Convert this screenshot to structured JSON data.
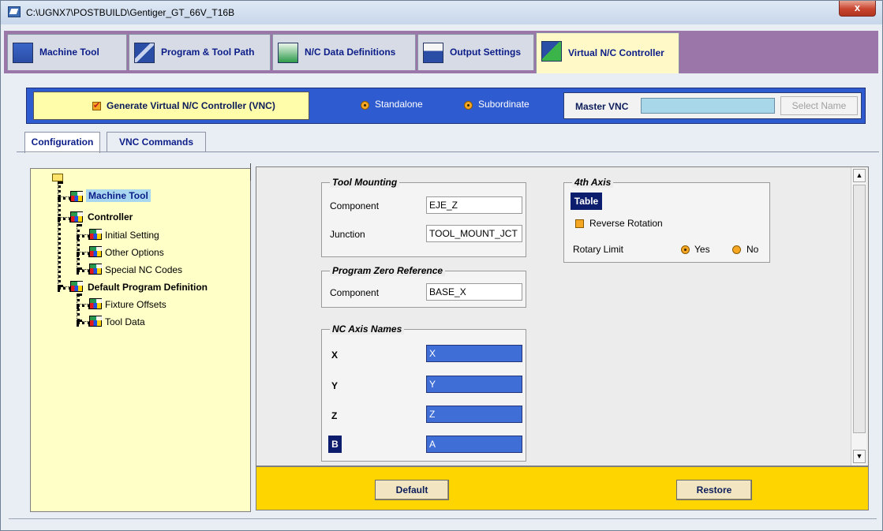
{
  "window": {
    "title": "C:\\UGNX7\\POSTBUILD\\Gentiger_GT_66V_T16B",
    "close_glyph": "x"
  },
  "main_tabs": [
    {
      "label": "Machine Tool",
      "icon": "machine-tool-icon"
    },
    {
      "label": "Program & Tool Path",
      "icon": "program-tool-path-icon"
    },
    {
      "label": "N/C Data Definitions",
      "icon": "nc-data-icon"
    },
    {
      "label": "Output Settings",
      "icon": "printer-icon"
    },
    {
      "label": "Virtual N/C Controller",
      "icon": "vnc-icon"
    }
  ],
  "vnc": {
    "generate_label": "Generate Virtual N/C Controller (VNC)",
    "generate_checked": true,
    "standalone_label": "Standalone",
    "subordinate_label": "Subordinate",
    "master_label": "Master VNC",
    "master_value": "",
    "select_name": "Select Name"
  },
  "sub_tabs": [
    "Configuration",
    "VNC Commands"
  ],
  "tree": {
    "nodes": [
      {
        "label": "Machine Tool",
        "level": 1,
        "bold": true,
        "selected": true
      },
      {
        "label": "Controller",
        "level": 1,
        "bold": true
      },
      {
        "label": "Initial Setting",
        "level": 2
      },
      {
        "label": "Other Options",
        "level": 2
      },
      {
        "label": "Special NC Codes",
        "level": 2
      },
      {
        "label": "Default Program Definition",
        "level": 1,
        "bold": true
      },
      {
        "label": "Fixture Offsets",
        "level": 2
      },
      {
        "label": "Tool Data",
        "level": 2
      }
    ]
  },
  "tool_mounting": {
    "title": "Tool Mounting",
    "component_label": "Component",
    "component_value": "EJE_Z",
    "junction_label": "Junction",
    "junction_value": "TOOL_MOUNT_JCT"
  },
  "program_zero": {
    "title": "Program Zero Reference",
    "component_label": "Component",
    "component_value": "BASE_X"
  },
  "axis_names": {
    "title": "NC Axis Names",
    "rows": [
      {
        "label": "X",
        "value": "X"
      },
      {
        "label": "Y",
        "value": "Y"
      },
      {
        "label": "Z",
        "value": "Z"
      },
      {
        "label": "B",
        "value": "A"
      }
    ]
  },
  "fourth_axis": {
    "title": "4th Axis",
    "type_label": "Table",
    "reverse_label": "Reverse Rotation",
    "rotary_limit_label": "Rotary Limit",
    "yes_label": "Yes",
    "no_label": "No",
    "rotary_limit_selected": "Yes"
  },
  "buttons": {
    "default": "Default",
    "restore": "Restore"
  },
  "colors": {
    "tab_strip": "#9a77a8",
    "vnc_bar": "#2f5bd0",
    "tree_bg": "#ffffc8",
    "button_bar": "#ffd500",
    "axis_field": "#3f6ed6"
  }
}
